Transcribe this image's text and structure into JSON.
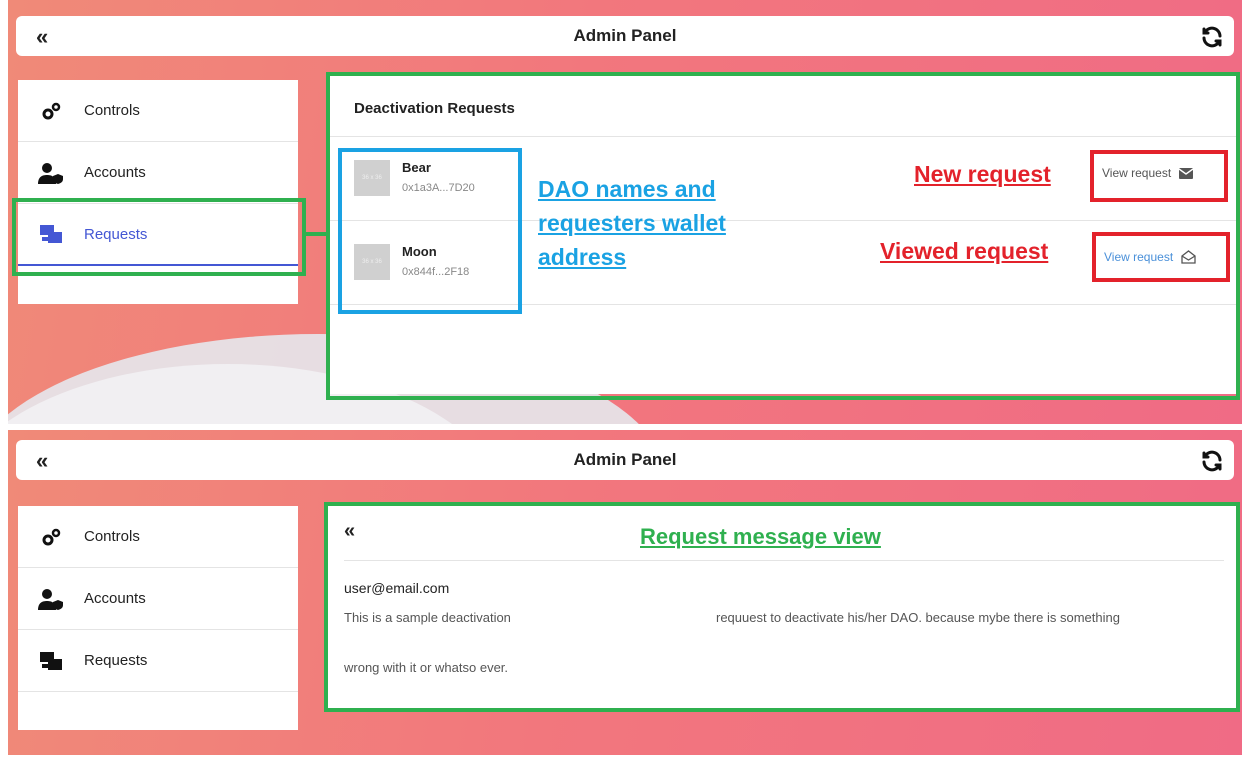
{
  "header": {
    "back_icon": "«",
    "title": "Admin Panel",
    "refresh_icon": "refresh-icon"
  },
  "sidebar": {
    "items": [
      {
        "label": "Controls",
        "icon": "gears-icon"
      },
      {
        "label": "Accounts",
        "icon": "user-shield-icon"
      },
      {
        "label": "Requests",
        "icon": "requests-icon"
      }
    ]
  },
  "requests": {
    "title": "Deactivation Requests",
    "thumb_text": "36 x 36",
    "rows": [
      {
        "name": "Bear",
        "address": "0x1a3A...7D20",
        "action": "View request",
        "icon": "envelope-closed-icon"
      },
      {
        "name": "Moon",
        "address": "0x844f...2F18",
        "action": "View request",
        "icon": "envelope-open-icon"
      }
    ]
  },
  "annotations": {
    "dao_names": [
      "DAO names and",
      "requesters wallet",
      "address"
    ],
    "new_request": "New request",
    "viewed_request": "Viewed request",
    "message_view": "Request message view"
  },
  "message": {
    "back_icon": "«",
    "email": "user@email.com",
    "line1a": "This is a sample deactivation",
    "line1b": "requuest to deactivate his/her DAO. because mybe there is something",
    "line2": "wrong with it or whatso ever."
  },
  "colors": {
    "accent": "#4457d4",
    "green": "#2fb04f",
    "blue": "#1aa2e3",
    "red": "#e3222b"
  }
}
